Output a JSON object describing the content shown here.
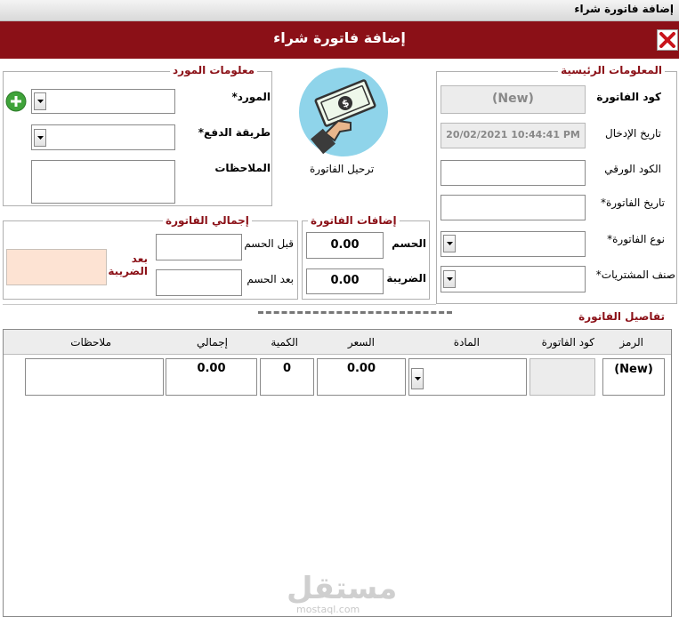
{
  "window": {
    "title": "إضافة فاتورة شراء"
  },
  "header": {
    "title": "إضافة فاتورة شراء"
  },
  "main_info": {
    "legend": "المعلومات الرئيسية",
    "invoice_code_label": "كود الفاتورة",
    "invoice_code_value": "(New)",
    "entry_date_label": "تاريخ الإدخال",
    "entry_date_value": "20/02/2021 10:44:41 PM",
    "paper_code_label": "الكود الورقي",
    "invoice_date_label": "تاريخ الفاتورة*",
    "invoice_type_label": "نوع الفاتورة*",
    "purchase_class_label": "صنف المشتريات*"
  },
  "supplier_info": {
    "legend": "معلومات المورد",
    "supplier_label": "المورد*",
    "payment_method_label": "طريقة الدفع*",
    "notes_label": "الملاحظات"
  },
  "post_invoice": {
    "label": "ترحيل الفاتورة"
  },
  "additions": {
    "legend": "إضافات الفاتورة",
    "discount_label": "الحسم",
    "discount_value": "0.00",
    "tax_label": "الضريبة",
    "tax_value": "0.00"
  },
  "totals": {
    "legend": "إجمالي الفاتورة",
    "before_discount_label": "قبل الحسم",
    "after_discount_label": "بعد الحسم",
    "after_tax_label": "بعد الضريبة"
  },
  "details": {
    "title": "تفاصيل الفاتورة",
    "columns": [
      "الرمز",
      "كود الفاتورة",
      "المادة",
      "السعر",
      "الكمية",
      "إجمالي",
      "ملاحظات"
    ],
    "row": {
      "code": "(New)",
      "price": "0.00",
      "quantity": "0",
      "total": "0.00"
    }
  },
  "watermark": {
    "text": "مستقل",
    "sub": "mostaql.com"
  },
  "colors": {
    "header_bg": "#8b1017",
    "accent_text": "#8b1017",
    "peach": "#fde3d3"
  },
  "icons": [
    "close-icon",
    "add-icon",
    "dropdown-arrow-icon",
    "money-hand-icon"
  ]
}
